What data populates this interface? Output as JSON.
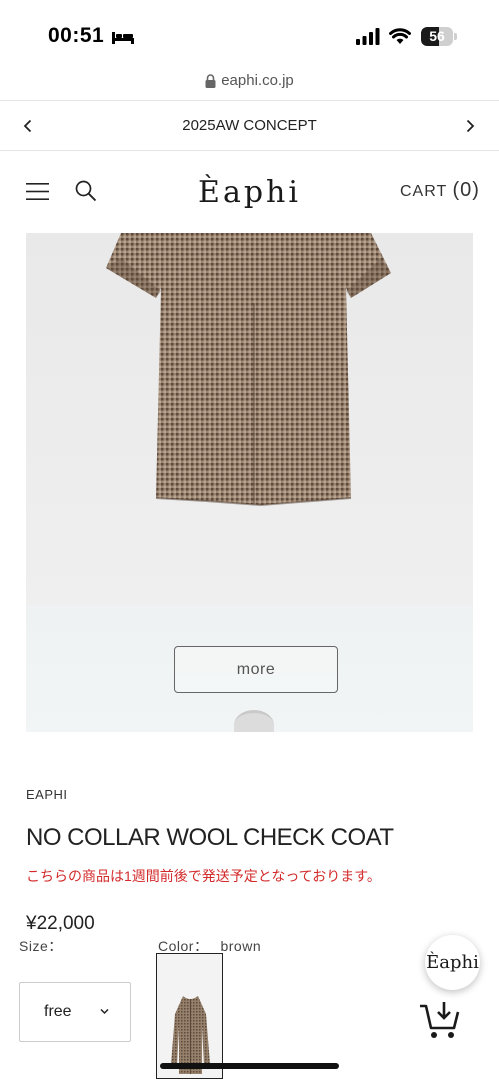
{
  "status_bar": {
    "time": "00:51",
    "battery_level": "56",
    "battery_fraction": 0.56
  },
  "browser": {
    "url": "eaphi.co.jp"
  },
  "announcement": {
    "text": "2025AW CONCEPT"
  },
  "header": {
    "logo": "Èaphi",
    "cart_label": "CART",
    "cart_count": "(0)"
  },
  "hero": {
    "more_label": "more"
  },
  "product": {
    "brand": "EAPHI",
    "title": "NO COLLAR WOOL CHECK COAT",
    "shipping_note": "こちらの商品は1週間前後で発送予定となっております。",
    "price": "¥22,000",
    "size_label": "Size：",
    "size_value": "free",
    "color_label": "Color：",
    "color_value": "brown"
  },
  "chat": {
    "label": "Èaphi"
  },
  "colors": {
    "accent_red": "#d32b2b",
    "coat_brown": "#8a7462"
  }
}
